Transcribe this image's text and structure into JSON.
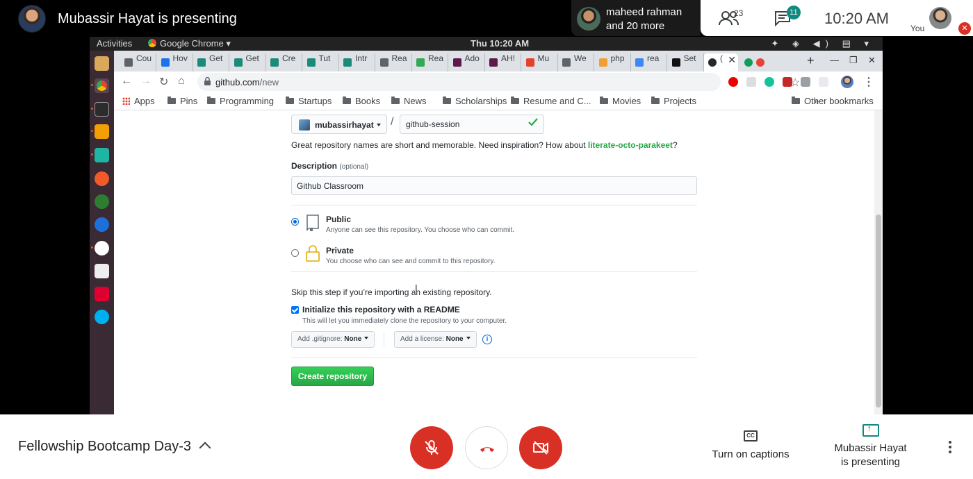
{
  "meet": {
    "presenter_title": "Mubassir Hayat is presenting",
    "other_participant": {
      "name": "maheed rahman",
      "more": "and 20 more"
    },
    "people_count": "23",
    "chat_badge": "11",
    "time": "10:20 AM",
    "self_label": "You",
    "meeting_name": "Fellowship Bootcamp Day-3",
    "captions_label": "Turn on captions",
    "presenting_label_1": "Mubassir Hayat",
    "presenting_label_2": "is presenting",
    "accent": "#d93025",
    "teal": "#0f8a80"
  },
  "desktop": {
    "activities": "Activities",
    "app_name": "Google Chrome ▾",
    "clock": "Thu 10:20 AM",
    "tray": "✦ ◈ ◀) ▤ ▾"
  },
  "browser": {
    "tabs": [
      {
        "label": "Cou",
        "color": "#5f6368"
      },
      {
        "label": "Hov",
        "color": "#1a73e8"
      },
      {
        "label": "Get",
        "color": "#1a8a7a"
      },
      {
        "label": "Get",
        "color": "#1a8a7a"
      },
      {
        "label": "Cre",
        "color": "#1a8a7a"
      },
      {
        "label": "Tut",
        "color": "#1a8a7a"
      },
      {
        "label": "Intr",
        "color": "#1a8a7a"
      },
      {
        "label": "Rea",
        "color": "#5f6368"
      },
      {
        "label": "Rea",
        "color": "#34a853"
      },
      {
        "label": "Ado",
        "color": "#5c1a4a"
      },
      {
        "label": "AH!",
        "color": "#5c1a4a"
      },
      {
        "label": "Mu",
        "color": "#e24329"
      },
      {
        "label": "We",
        "color": "#5f6368"
      },
      {
        "label": "php",
        "color": "#f0a030"
      },
      {
        "label": "rea",
        "color": "#4285f4"
      },
      {
        "label": "Set",
        "color": "#111111"
      }
    ],
    "active_tab_close": "✕",
    "url_host": "github.com",
    "url_path": "/new",
    "bookmarks": [
      "Apps",
      "Pins",
      "Programming",
      "Startups",
      "Books",
      "News",
      "Scholarships",
      "Resume and C...",
      "Movies",
      "Projects"
    ],
    "bookmarks_more": "»",
    "other_bookmarks": "Other bookmarks"
  },
  "form": {
    "owner": "mubassirhayat",
    "slash": "/",
    "repo_name": "github-session",
    "hint_prefix": "Great repository names are short and memorable. Need inspiration? How about ",
    "hint_suggestion": "literate-octo-parakeet",
    "hint_suffix": "?",
    "description_label": "Description",
    "description_optional": "(optional)",
    "description_value": "Github Classroom",
    "visibility": [
      {
        "title": "Public",
        "note": "Anyone can see this repository. You choose who can commit.",
        "selected": true
      },
      {
        "title": "Private",
        "note": "You choose who can see and commit to this repository.",
        "selected": false
      }
    ],
    "skip_text": "Skip this step if you’re importing an existing repository.",
    "readme_label": "Initialize this repository with a README",
    "readme_note": "This will let you immediately clone the repository to your computer.",
    "readme_checked": true,
    "gitignore_label": "Add .gitignore:",
    "gitignore_value": "None",
    "license_label": "Add a license:",
    "license_value": "None",
    "create_button": "Create repository"
  }
}
